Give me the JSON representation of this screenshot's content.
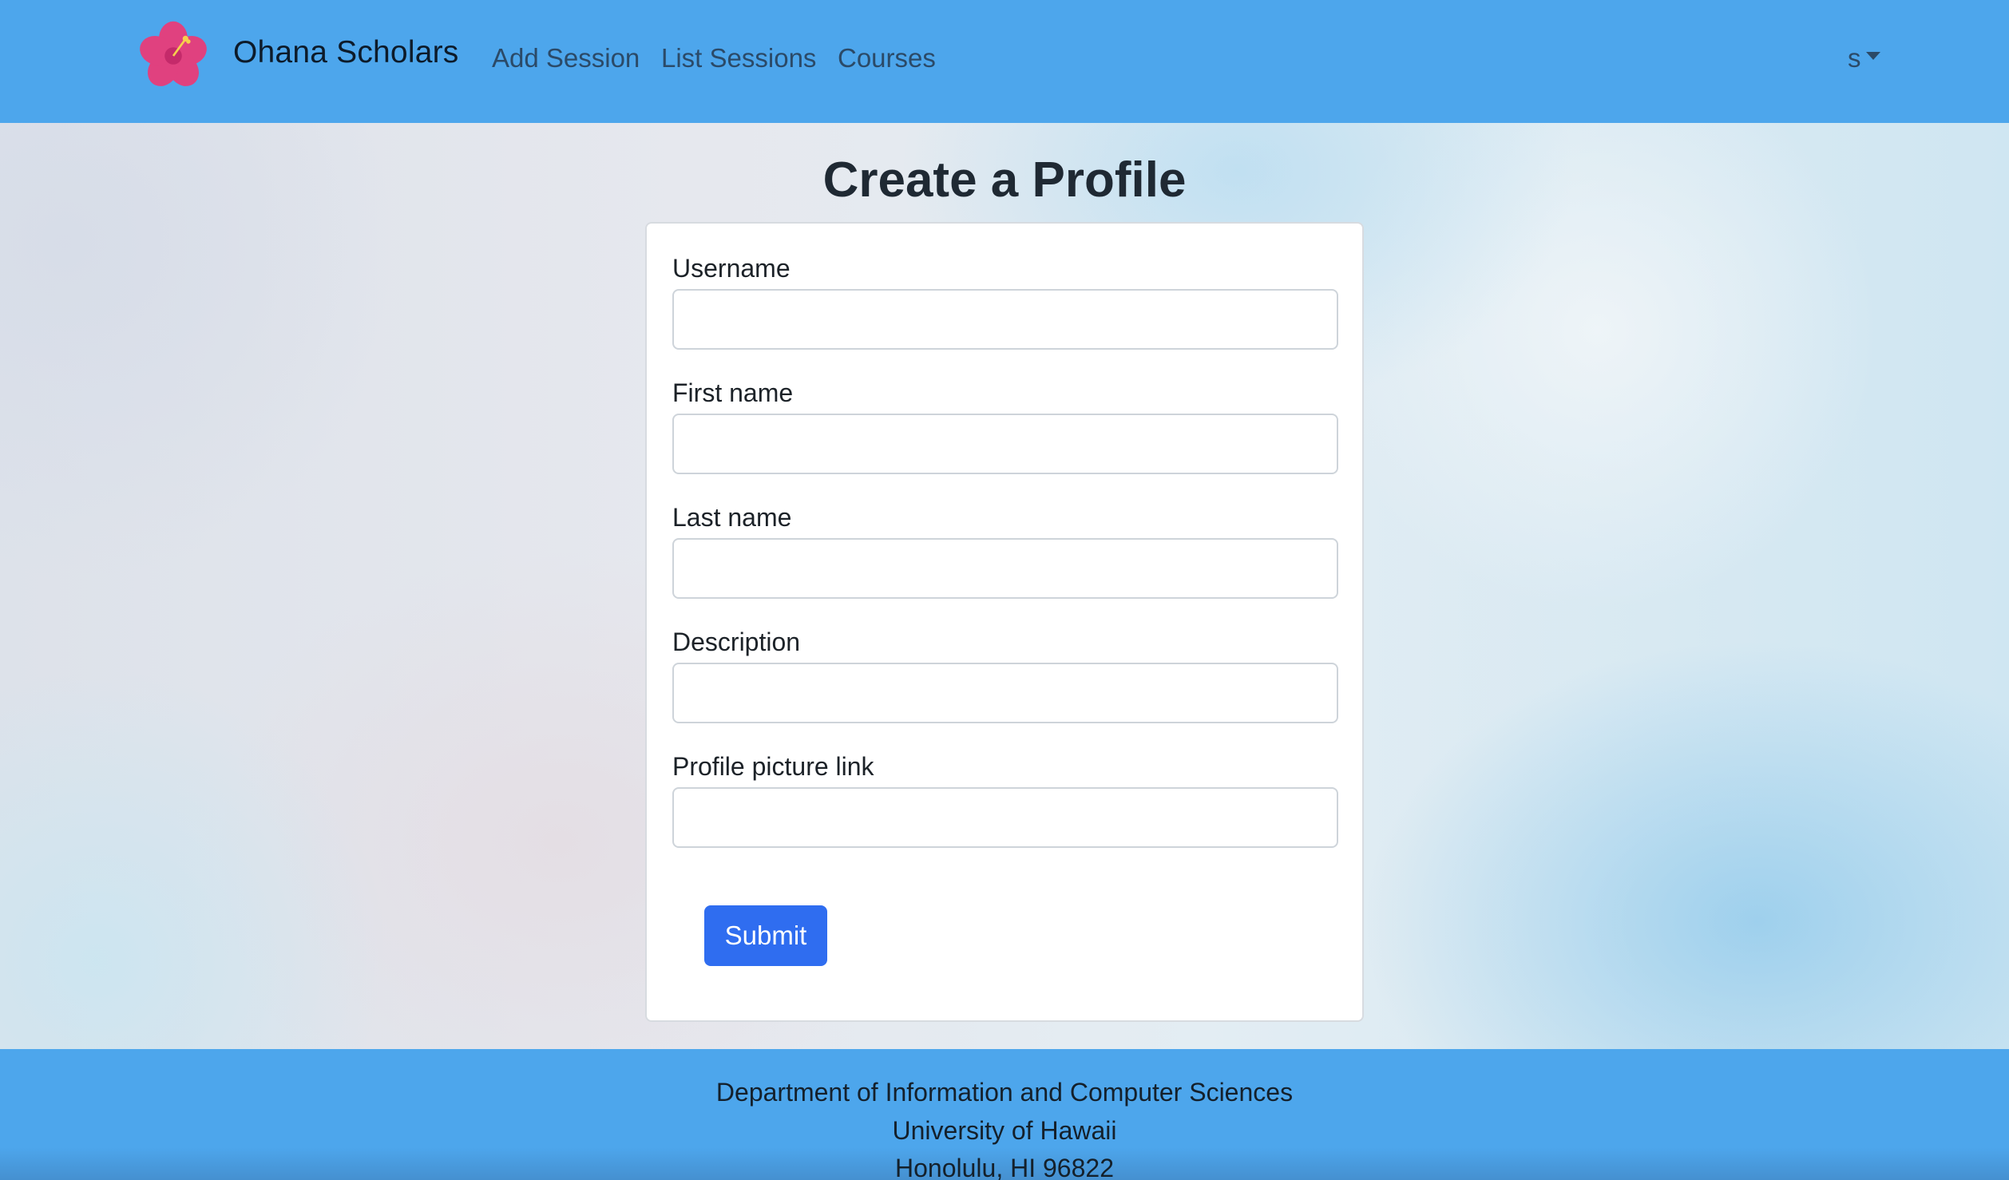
{
  "navbar": {
    "brand_name": "Ohana Scholars",
    "logo_icon": "hibiscus-flower-icon",
    "links": [
      {
        "label": "Add Session"
      },
      {
        "label": "List Sessions"
      },
      {
        "label": "Courses"
      }
    ],
    "user_menu_label": "s",
    "background_color": "#4da6ec"
  },
  "form": {
    "title": "Create a Profile",
    "fields": [
      {
        "label": "Username",
        "value": ""
      },
      {
        "label": "First name",
        "value": ""
      },
      {
        "label": "Last name",
        "value": ""
      },
      {
        "label": "Description",
        "value": ""
      },
      {
        "label": "Profile picture link",
        "value": ""
      }
    ],
    "submit_label": "Submit",
    "submit_color": "#2f6df0"
  },
  "footer": {
    "lines": [
      "Department of Information and Computer Sciences",
      "University of Hawaii",
      "Honolulu, HI 96822"
    ]
  }
}
